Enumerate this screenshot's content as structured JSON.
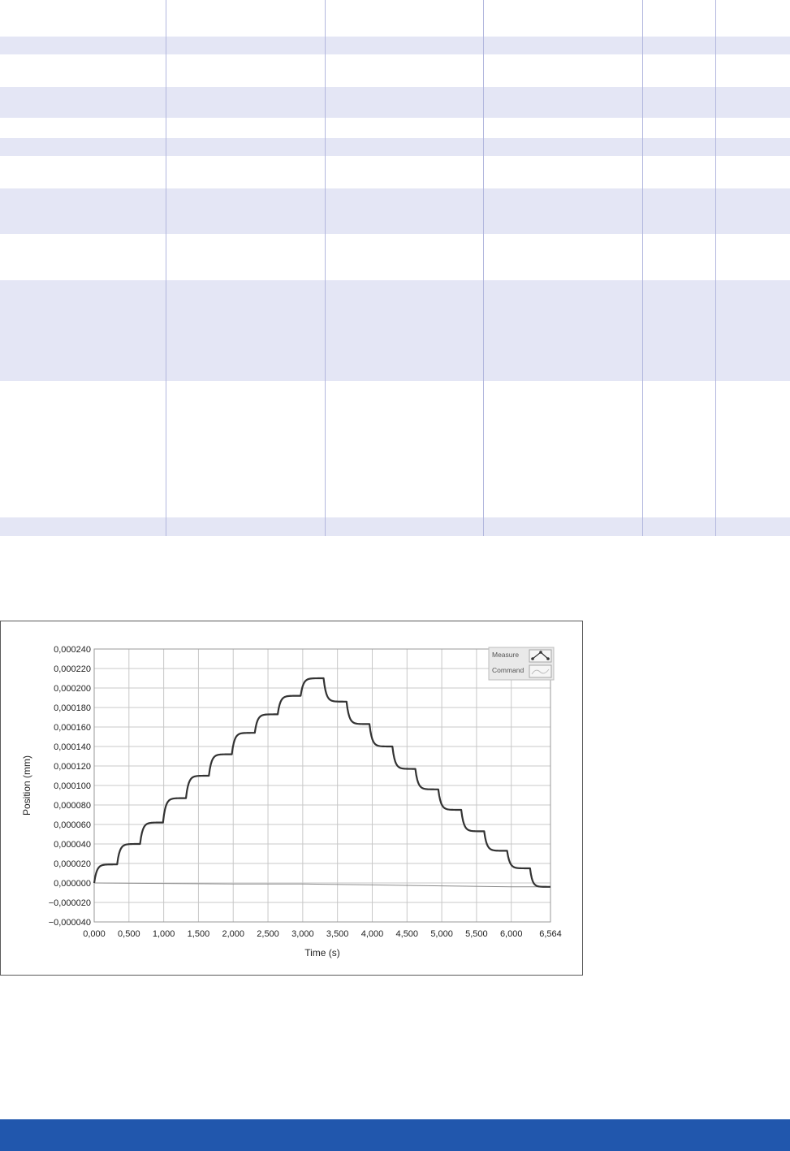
{
  "colors": {
    "row_band": "#e4e6f5",
    "column_rule": "#b3b8de",
    "footer_bar": "#2157ad",
    "measure_line": "#333333",
    "command_line": "#8a8a8a",
    "grid": "#c8c8c8"
  },
  "chart_data": {
    "type": "line",
    "title": "",
    "xlabel": "Time (s)",
    "ylabel": "Position (mm)",
    "xlim": [
      0,
      6.564
    ],
    "ylim": [
      -4e-05,
      0.00024
    ],
    "grid": true,
    "legend_position": "top-right",
    "x_tick_labels": [
      "0,000",
      "0,500",
      "1,000",
      "1,500",
      "2,000",
      "2,500",
      "3,000",
      "3,500",
      "4,000",
      "4,500",
      "5,000",
      "5,500",
      "6,000",
      "6,564"
    ],
    "y_tick_labels": [
      "0,000240",
      "0,000220",
      "0,000200",
      "0,000180",
      "0,000160",
      "0,000140",
      "0,000120",
      "0,000100",
      "0,000080",
      "0,000060",
      "0,000040",
      "0,000020",
      "0,000000",
      "−0,000020",
      "−0,000040"
    ],
    "legend": [
      {
        "name": "Measure",
        "icon": "line-with-markers-icon"
      },
      {
        "name": "Command",
        "icon": "smooth-line-icon"
      }
    ],
    "series": [
      {
        "name": "Measure",
        "x": [
          0,
          0.33,
          0.66,
          0.99,
          1.32,
          1.65,
          1.98,
          2.31,
          2.64,
          2.97,
          3.3,
          3.63,
          3.96,
          4.29,
          4.62,
          4.95,
          5.28,
          5.61,
          5.94,
          6.27
        ],
        "start_y": [
          0,
          1.9e-05,
          4e-05,
          6.2e-05,
          8.7e-05,
          0.00011,
          0.000132,
          0.000154,
          0.000173,
          0.000192,
          0.00021,
          0.000186,
          0.000163,
          0.00014,
          0.000117,
          9.6e-05,
          7.5e-05,
          5.3e-05,
          3.3e-05,
          1.5e-05
        ],
        "end_y": [
          1.9e-05,
          4e-05,
          6.2e-05,
          8.7e-05,
          0.00011,
          0.000132,
          0.000154,
          0.000173,
          0.000192,
          0.00021,
          0.000186,
          0.000163,
          0.00014,
          0.000117,
          9.6e-05,
          7.5e-05,
          5.3e-05,
          3.3e-05,
          1.5e-05,
          -4e-06
        ]
      },
      {
        "name": "Command",
        "x": [
          0,
          1.0,
          2.0,
          3.0,
          4.0,
          5.0,
          6.0,
          6.564
        ],
        "y": [
          0,
          -5e-07,
          -1e-06,
          -1e-06,
          -2e-06,
          -3e-06,
          -4e-06,
          -4e-06
        ]
      }
    ]
  }
}
